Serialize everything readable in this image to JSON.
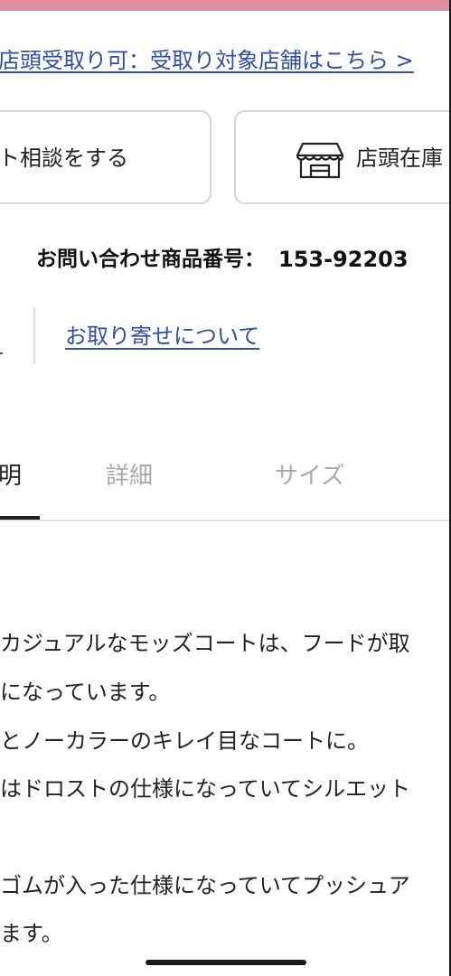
{
  "header": {
    "accent_color": "#e08ea0",
    "pickup_link": "店頭受取り可：受取り対象店舗はこちら >"
  },
  "actions": {
    "chat_label": "ット相談をする",
    "store_icon": "store-icon",
    "store_stock_label": "店頭在庫"
  },
  "inquiry": {
    "label": "お問い合わせ商品番号：",
    "number": "153-92203"
  },
  "links": {
    "order_info": "お取り寄せについて"
  },
  "tabs": [
    {
      "label": "明",
      "active": true
    },
    {
      "label": "詳細",
      "active": false
    },
    {
      "label": "サイズ",
      "active": false
    }
  ],
  "description": {
    "lines": [
      "カジュアルなモッズコートは、フードが取",
      "になっています。",
      "とノーカラーのキレイ目なコートに。",
      "はドロストの仕様になっていてシルエット",
      "",
      "ゴムが入った仕様になっていてプッシュア",
      "ます。"
    ]
  }
}
